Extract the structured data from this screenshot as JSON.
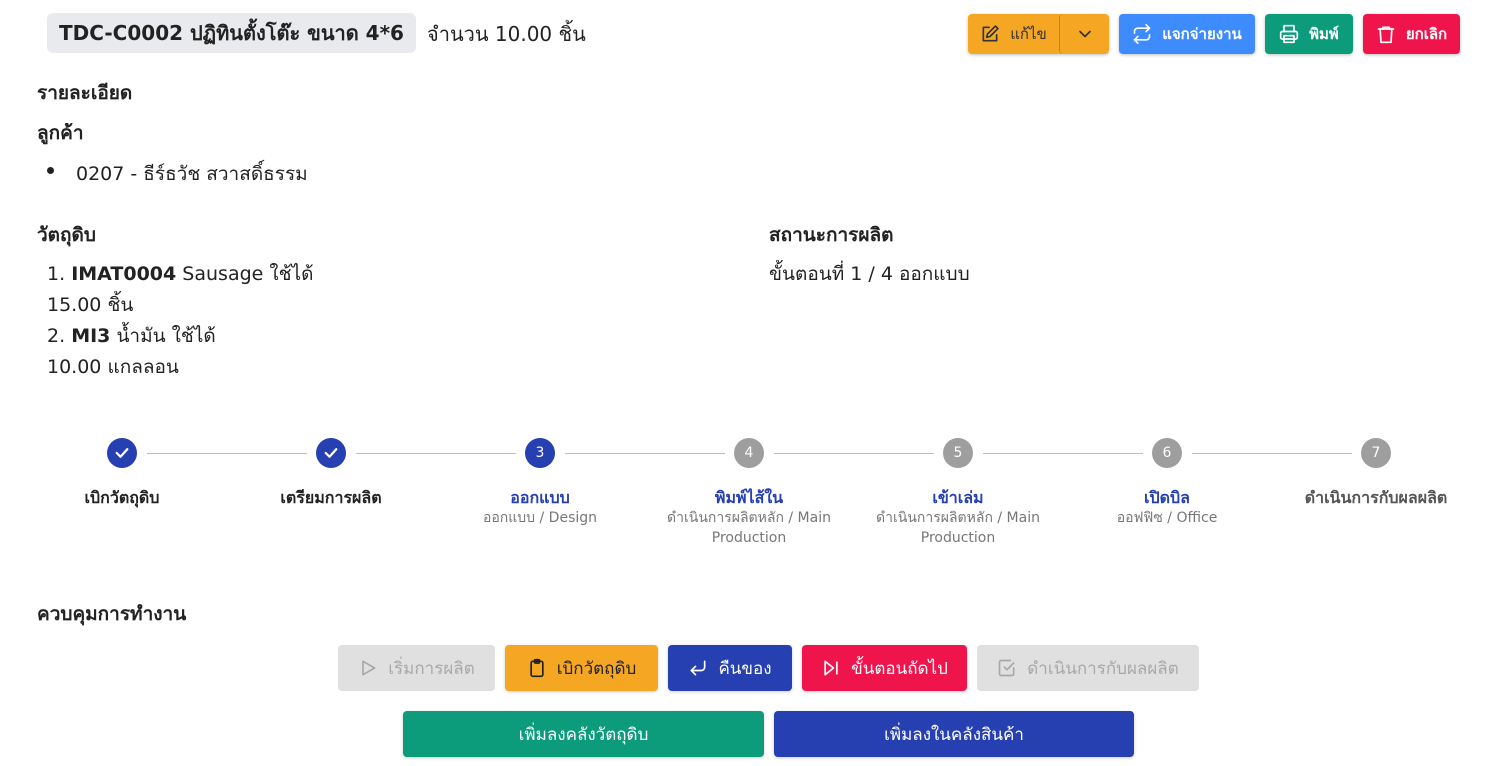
{
  "header": {
    "title": "TDC-C0002 ปฏิทินตั้งโต๊ะ ขนาด 4*6",
    "quantity_text": "จำนวน 10.00 ชิ้น",
    "actions": {
      "edit_label": "แก้ไข",
      "assign_label": "แจกจ่ายงาน",
      "print_label": "พิมพ์",
      "cancel_label": "ยกเลิก"
    }
  },
  "details": {
    "heading": "รายละเอียด",
    "customer_heading": "ลูกค้า",
    "customers": [
      "0207 - ธีร์ธวัช สวาสดิ์ธรรม"
    ]
  },
  "materials": {
    "heading": "วัตถุดิบ",
    "items": [
      {
        "index": "1.",
        "code": "IMAT0004",
        "name": "Sausage ใช้ได้",
        "qty": "15.00",
        "unit": "ชิ้น"
      },
      {
        "index": "2.",
        "code": "MI3",
        "name": "น้ำมัน ใช้ได้",
        "qty": "10.00",
        "unit": "แกลลอน"
      }
    ]
  },
  "production_status": {
    "heading": "สถานะการผลิต",
    "text": "ขั้นตอนที่ 1 / 4 ออกแบบ"
  },
  "steps": [
    {
      "number": "1",
      "state": "done",
      "label": "เบิกวัตถุดิบ",
      "sub": ""
    },
    {
      "number": "2",
      "state": "done",
      "label": "เตรียมการผลิต",
      "sub": ""
    },
    {
      "number": "3",
      "state": "active",
      "label": "ออกแบบ",
      "sub": "ออกแบบ / Design"
    },
    {
      "number": "4",
      "state": "pending",
      "label": "พิมพ์ไส้ใน",
      "sub": "ดำเนินการผลิตหลัก / Main Production"
    },
    {
      "number": "5",
      "state": "pending",
      "label": "เข้าเล่ม",
      "sub": "ดำเนินการผลิตหลัก / Main Production"
    },
    {
      "number": "6",
      "state": "pending",
      "label": "เปิดบิล",
      "sub": "ออฟฟิซ / Office"
    },
    {
      "number": "7",
      "state": "pending",
      "label": "ดำเนินการกับผลผลิต",
      "sub": ""
    }
  ],
  "controls": {
    "heading": "ควบคุมการทำงาน",
    "start_label": "เริ่มการผลิต",
    "withdraw_label": "เบิกวัตถุดิบ",
    "return_label": "คืนของ",
    "next_step_label": "ขั้นตอนถัดไป",
    "handle_output_label": "ดำเนินการกับผลผลิต",
    "add_material_stock_label": "เพิ่มลงคลังวัตถุดิบ",
    "add_product_stock_label": "เพิ่มลงในคลังสินค้า"
  },
  "colors": {
    "primary": "#263fb1",
    "warning": "#f5a623",
    "info": "#3d8bfd",
    "success": "#0c9b7b",
    "danger": "#f0144c",
    "disabled": "#e0e0e0",
    "pending_step": "#9e9e9e"
  }
}
